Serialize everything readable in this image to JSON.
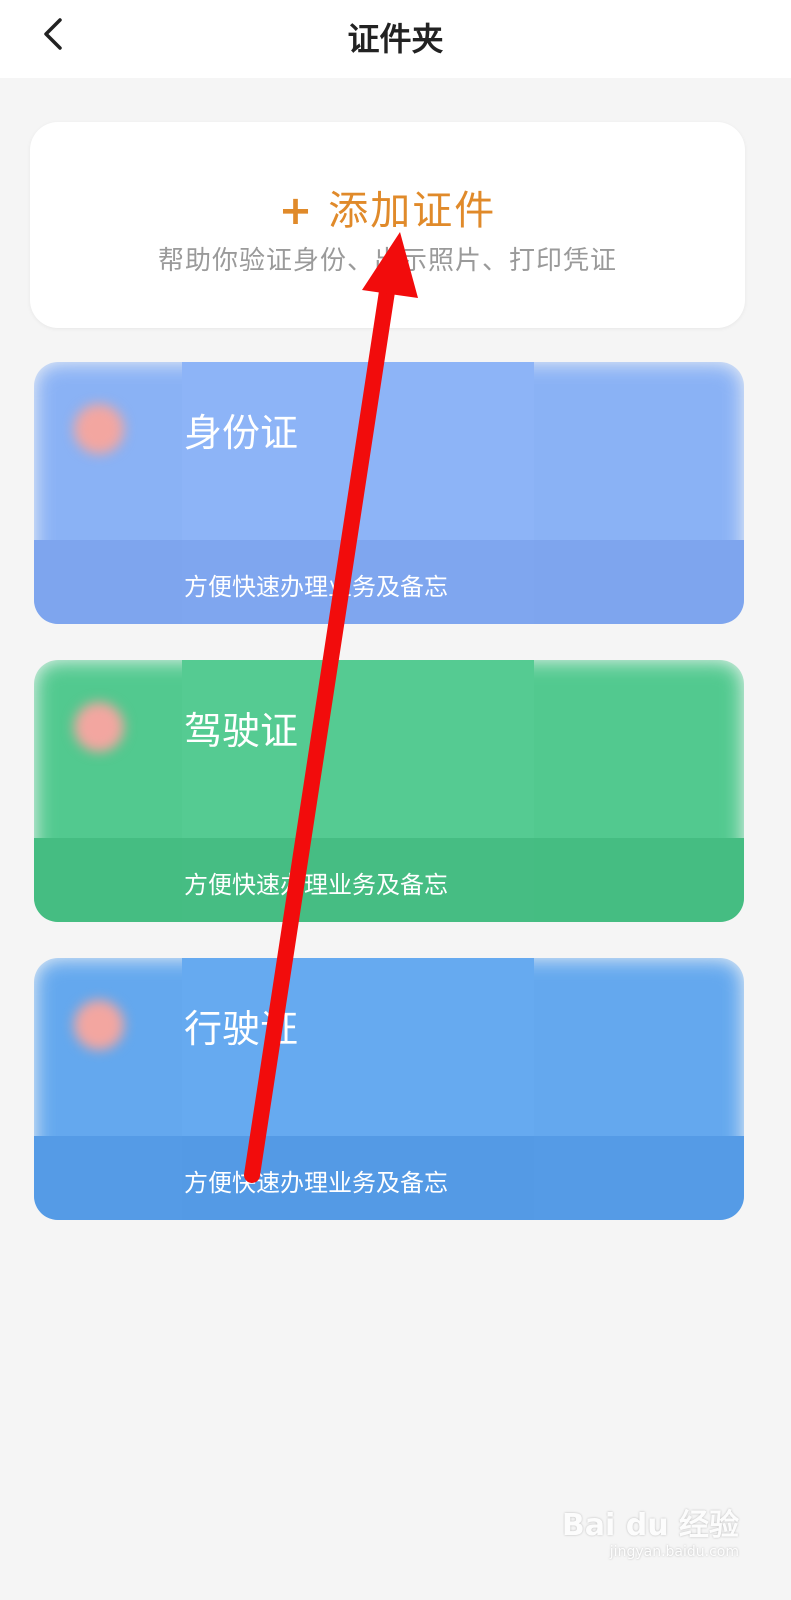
{
  "header": {
    "title": "证件夹",
    "back_icon": "chevron-left-icon"
  },
  "add_card": {
    "plus": "+",
    "title": "添加证件",
    "subtitle": "帮助你验证身份、出示照片、打印凭证"
  },
  "cards": [
    {
      "name": "身份证",
      "desc": "方便快速办理业务及备忘"
    },
    {
      "name": "驾驶证",
      "desc": "方便快速办理业务及备忘"
    },
    {
      "name": "行驶证",
      "desc": "方便快速办理业务及备忘"
    }
  ],
  "colors": {
    "accent": "#e08a2a",
    "id_card": "#8db4f7",
    "drive_card": "#55cb92",
    "vehicle_card": "#66aaf0",
    "arrow": "#f20c0c"
  },
  "watermark": {
    "main": "Bai du 经验",
    "sub": "jingyan.baidu.com"
  }
}
